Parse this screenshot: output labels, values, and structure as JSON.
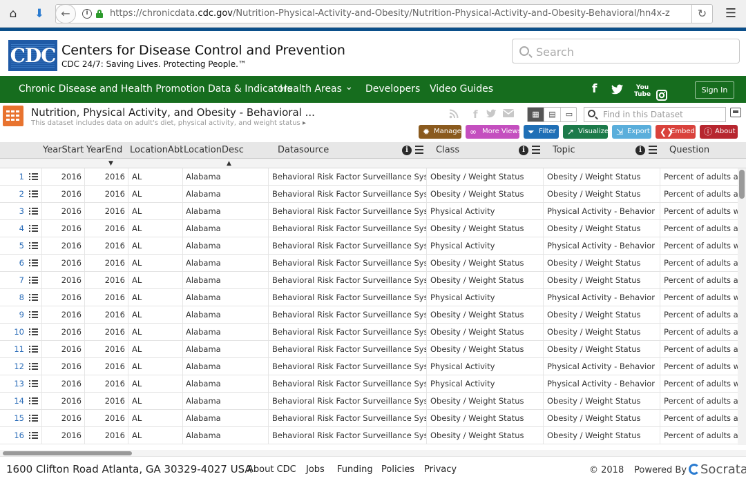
{
  "browser": {
    "url_prefix": "https://chronicdata.",
    "url_domain": "cdc.gov",
    "url_path": "/Nutrition-Physical-Activity-and-Obesity/Nutrition-Physical-Activity-and-Obesity-Behavioral/hn4x-z"
  },
  "header": {
    "logo_text": "CDC",
    "title": "Centers for Disease Control and Prevention",
    "subtitle": "CDC 24/7: Saving Lives. Protecting People.™",
    "search_placeholder": "Search"
  },
  "nav": {
    "items": [
      "Chronic Disease and Health Promotion Data & Indicators",
      "Health Areas",
      "Developers",
      "Video Guides"
    ],
    "health_areas_caret": "⌄",
    "social": [
      "facebook-icon",
      "twitter-icon",
      "youtube-icon",
      "instagram-icon"
    ],
    "youtube_top": "You",
    "youtube_bottom": "Tube",
    "sign_in": "Sign In"
  },
  "dataset": {
    "title": "Nutrition, Physical Activity, and Obesity - Behavioral ...",
    "description": "This dataset includes data on adult's diet, physical activity, and weight status",
    "find_placeholder": "Find in this Dataset",
    "buttons": [
      {
        "label": "Manage",
        "color": "#8a5a1e",
        "icon": "gear-icon"
      },
      {
        "label": "More Views",
        "color": "#c44fbf",
        "icon": "binoculars-icon"
      },
      {
        "label": "Filter",
        "color": "#1f6fb6",
        "icon": "filter-icon"
      },
      {
        "label": "Visualize",
        "color": "#1c7a4a",
        "icon": "chart-icon"
      },
      {
        "label": "Export",
        "color": "#5aaedb",
        "icon": "export-icon"
      },
      {
        "label": "Embed",
        "color": "#d9423c",
        "icon": "embed-icon"
      },
      {
        "label": "About",
        "color": "#b7262f",
        "icon": "info-icon"
      }
    ]
  },
  "table": {
    "columns": [
      "YearStart",
      "YearEnd",
      "LocationAbbr",
      "LocationDesc",
      "Datasource",
      "Class",
      "Topic",
      "Question"
    ],
    "rows": [
      {
        "n": "1",
        "ys": "2016",
        "ye": "2016",
        "la": "AL",
        "ld": "Alabama",
        "src": "Behavioral Risk Factor Surveillance System",
        "cls": "Obesity / Weight Status",
        "top": "Obesity / Weight Status",
        "q": "Percent of adults aged"
      },
      {
        "n": "2",
        "ys": "2016",
        "ye": "2016",
        "la": "AL",
        "ld": "Alabama",
        "src": "Behavioral Risk Factor Surveillance System",
        "cls": "Obesity / Weight Status",
        "top": "Obesity / Weight Status",
        "q": "Percent of adults aged"
      },
      {
        "n": "3",
        "ys": "2016",
        "ye": "2016",
        "la": "AL",
        "ld": "Alabama",
        "src": "Behavioral Risk Factor Surveillance System",
        "cls": "Physical Activity",
        "top": "Physical Activity - Behavior",
        "q": "Percent of adults who"
      },
      {
        "n": "4",
        "ys": "2016",
        "ye": "2016",
        "la": "AL",
        "ld": "Alabama",
        "src": "Behavioral Risk Factor Surveillance System",
        "cls": "Obesity / Weight Status",
        "top": "Obesity / Weight Status",
        "q": "Percent of adults aged"
      },
      {
        "n": "5",
        "ys": "2016",
        "ye": "2016",
        "la": "AL",
        "ld": "Alabama",
        "src": "Behavioral Risk Factor Surveillance System",
        "cls": "Physical Activity",
        "top": "Physical Activity - Behavior",
        "q": "Percent of adults who"
      },
      {
        "n": "6",
        "ys": "2016",
        "ye": "2016",
        "la": "AL",
        "ld": "Alabama",
        "src": "Behavioral Risk Factor Surveillance System",
        "cls": "Obesity / Weight Status",
        "top": "Obesity / Weight Status",
        "q": "Percent of adults aged"
      },
      {
        "n": "7",
        "ys": "2016",
        "ye": "2016",
        "la": "AL",
        "ld": "Alabama",
        "src": "Behavioral Risk Factor Surveillance System",
        "cls": "Obesity / Weight Status",
        "top": "Obesity / Weight Status",
        "q": "Percent of adults aged"
      },
      {
        "n": "8",
        "ys": "2016",
        "ye": "2016",
        "la": "AL",
        "ld": "Alabama",
        "src": "Behavioral Risk Factor Surveillance System",
        "cls": "Physical Activity",
        "top": "Physical Activity - Behavior",
        "q": "Percent of adults who"
      },
      {
        "n": "9",
        "ys": "2016",
        "ye": "2016",
        "la": "AL",
        "ld": "Alabama",
        "src": "Behavioral Risk Factor Surveillance System",
        "cls": "Obesity / Weight Status",
        "top": "Obesity / Weight Status",
        "q": "Percent of adults aged"
      },
      {
        "n": "10",
        "ys": "2016",
        "ye": "2016",
        "la": "AL",
        "ld": "Alabama",
        "src": "Behavioral Risk Factor Surveillance System",
        "cls": "Obesity / Weight Status",
        "top": "Obesity / Weight Status",
        "q": "Percent of adults aged"
      },
      {
        "n": "11",
        "ys": "2016",
        "ye": "2016",
        "la": "AL",
        "ld": "Alabama",
        "src": "Behavioral Risk Factor Surveillance System",
        "cls": "Obesity / Weight Status",
        "top": "Obesity / Weight Status",
        "q": "Percent of adults aged"
      },
      {
        "n": "12",
        "ys": "2016",
        "ye": "2016",
        "la": "AL",
        "ld": "Alabama",
        "src": "Behavioral Risk Factor Surveillance System",
        "cls": "Physical Activity",
        "top": "Physical Activity - Behavior",
        "q": "Percent of adults who"
      },
      {
        "n": "13",
        "ys": "2016",
        "ye": "2016",
        "la": "AL",
        "ld": "Alabama",
        "src": "Behavioral Risk Factor Surveillance System",
        "cls": "Physical Activity",
        "top": "Physical Activity - Behavior",
        "q": "Percent of adults who"
      },
      {
        "n": "14",
        "ys": "2016",
        "ye": "2016",
        "la": "AL",
        "ld": "Alabama",
        "src": "Behavioral Risk Factor Surveillance System",
        "cls": "Obesity / Weight Status",
        "top": "Obesity / Weight Status",
        "q": "Percent of adults aged"
      },
      {
        "n": "15",
        "ys": "2016",
        "ye": "2016",
        "la": "AL",
        "ld": "Alabama",
        "src": "Behavioral Risk Factor Surveillance System",
        "cls": "Obesity / Weight Status",
        "top": "Obesity / Weight Status",
        "q": "Percent of adults aged"
      },
      {
        "n": "16",
        "ys": "2016",
        "ye": "2016",
        "la": "AL",
        "ld": "Alabama",
        "src": "Behavioral Risk Factor Surveillance System",
        "cls": "Obesity / Weight Status",
        "top": "Obesity / Weight Status",
        "q": "Percent of adults aged"
      }
    ]
  },
  "footer": {
    "address": "1600 Clifton Road Atlanta, GA 30329-4027 USA",
    "links": [
      "About CDC",
      "Jobs",
      "Funding",
      "Policies",
      "Privacy"
    ],
    "copyright": "© 2018",
    "powered_by": "Powered By",
    "brand": "Socrata"
  },
  "colors": {
    "nav_green": "#166d1e",
    "cdc_blue": "#0b4f8a",
    "dataset_icon_orange": "#e8732f",
    "row_link_blue": "#2a6cb8"
  }
}
